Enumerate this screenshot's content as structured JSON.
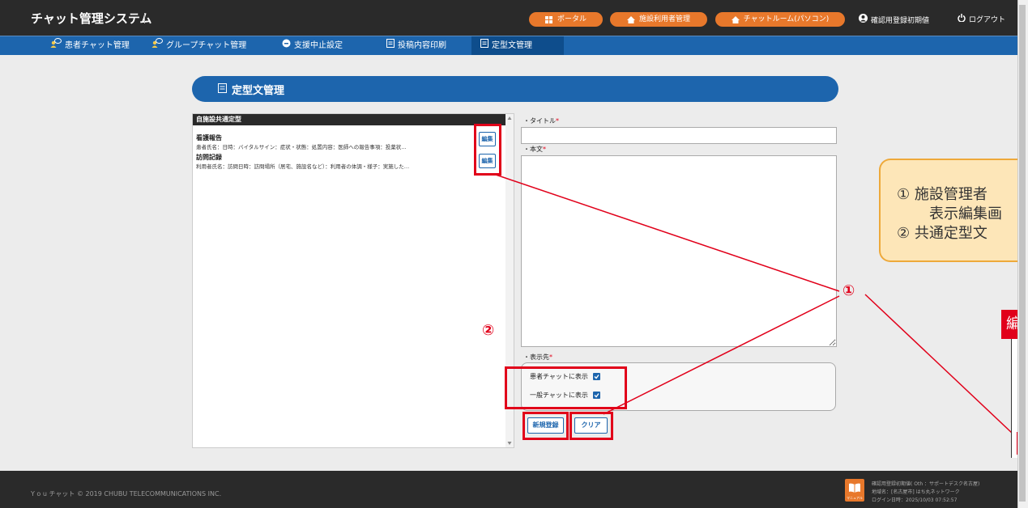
{
  "header": {
    "app_title": "チャット管理システム",
    "portal_label": "ポータル",
    "facility_user_label": "施設利用者管理",
    "chatroom_label": "チャットルーム(パソコン)",
    "user_label": "確認用登録初期値",
    "logout_label": "ログアウト",
    "accent_color": "#e8782b"
  },
  "nav": {
    "items": [
      {
        "label": "患者チャット管理"
      },
      {
        "label": "グループチャット管理"
      },
      {
        "label": "支援中止設定"
      },
      {
        "label": "投稿内容印刷"
      },
      {
        "label": "定型文管理"
      }
    ],
    "active_index": 4,
    "bar_color": "#1d65ad"
  },
  "page": {
    "title": "定型文管理"
  },
  "list": {
    "header": "自施設共通定型",
    "items": [
      {
        "title": "看護報告",
        "body": "患者氏名：日時：バイタルサイン：症状・状態：処置内容：医師への報告事項：投薬状…",
        "edit_label": "編集"
      },
      {
        "title": "訪問記録",
        "body": "利用者氏名：訪問日時：訪問場所（居宅、施設名など）：利用者の体調・様子：実施した…",
        "edit_label": "編集"
      }
    ]
  },
  "form": {
    "title_label": "・タイトル",
    "body_label": "・本文",
    "display_label": "・表示先",
    "required_mark": "*",
    "title_value": "",
    "body_value": "",
    "show_patient_chat": "患者チャットに表示",
    "show_general_chat": "一般チャットに表示",
    "patient_checked": true,
    "general_checked": true,
    "new_button": "新規登録",
    "clear_button": "クリア"
  },
  "annotations": {
    "marker_1": "①",
    "marker_2": "②",
    "callout_line1": "①  施設管理者",
    "callout_line2": "表示編集画",
    "callout_line3": "②  共通定型文",
    "mini_label": "編",
    "highlight_color": "#e1001a"
  },
  "footer": {
    "copyright": "Y o u チャット © 2019 CHUBU TELECOMMUNICATIONS INC.",
    "manual_label": "マニュアル",
    "info_line1": "確認用登録初期値( Oth ：サポートデスク名古屋)",
    "info_line2": "地域名：[名古屋市] はち丸ネットワーク",
    "info_line3": "ログイン日時：2025/10/03 07:52:57"
  }
}
